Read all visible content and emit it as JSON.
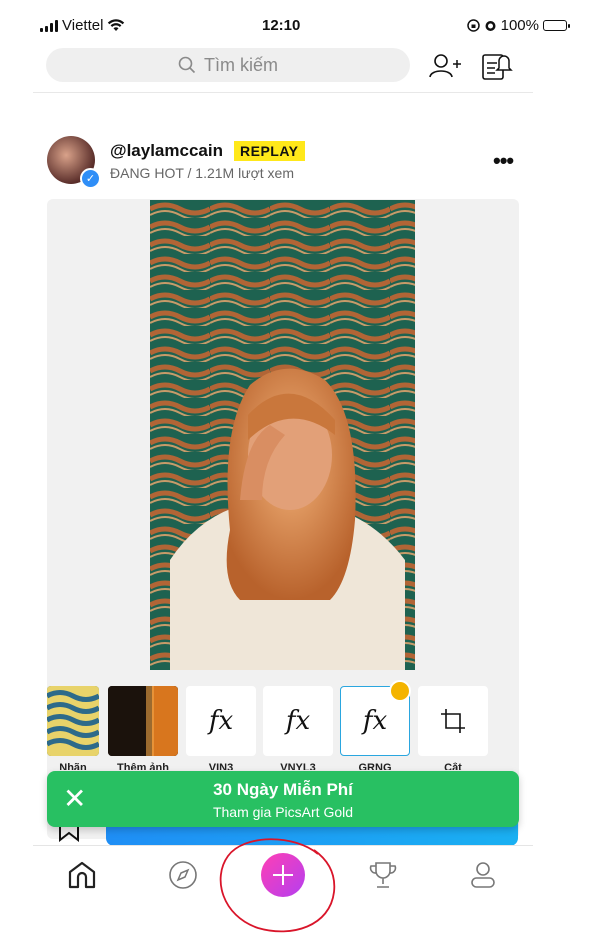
{
  "status_bar": {
    "carrier": "Viettel",
    "time": "12:10",
    "battery": "100%"
  },
  "search": {
    "placeholder": "Tìm kiếm"
  },
  "post": {
    "username": "@laylamccain",
    "badge": "REPLAY",
    "meta": "ĐANG HOT / 1.21M lượt xem"
  },
  "tools": [
    {
      "label": "Nhãn",
      "kind": "image",
      "icon": "swirl-thumbnail"
    },
    {
      "label": "Thêm ảnh",
      "kind": "image",
      "icon": "photo-thumbnail"
    },
    {
      "label": "VIN3",
      "kind": "fx",
      "glyph": "fx"
    },
    {
      "label": "VNYL3",
      "kind": "fx",
      "glyph": "fx"
    },
    {
      "label": "GRNG",
      "kind": "fx",
      "glyph": "fx",
      "selected": true,
      "premium": true
    },
    {
      "label": "Cắt",
      "kind": "crop",
      "icon": "crop-icon"
    }
  ],
  "banner": {
    "title": "30 Ngày Miễn Phí",
    "subtitle": "Tham gia PicsArt Gold"
  },
  "nav": {
    "items": [
      "home-icon",
      "explore-icon",
      "create-icon",
      "challenges-icon",
      "profile-icon"
    ]
  },
  "colors": {
    "accent_green": "#28c062",
    "badge_yellow": "#ffe81a",
    "plus_gradient": [
      "#ff3fb4",
      "#b43ff0"
    ],
    "selection_blue": "#2aa6df"
  }
}
